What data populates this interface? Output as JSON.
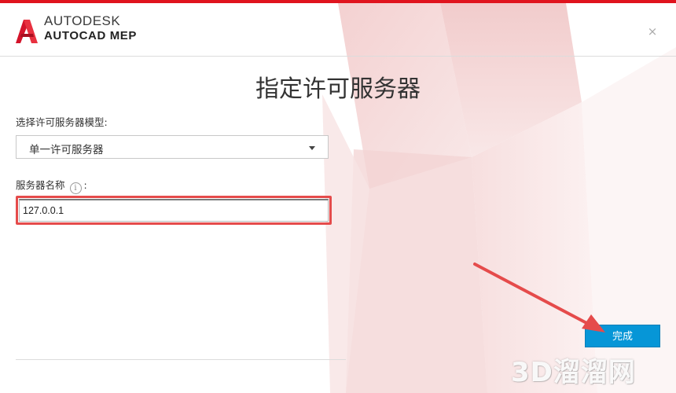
{
  "header": {
    "brand_line1": "AUTODESK",
    "brand_line2": "AUTOCAD MEP",
    "close_glyph": "×"
  },
  "main": {
    "title": "指定许可服务器",
    "server_model_label": "选择许可服务器模型:",
    "server_model_value": "单一许可服务器",
    "server_name_label": "服务器名称",
    "server_name_suffix": ":",
    "info_glyph": "i",
    "server_name_value": "127.0.0.1"
  },
  "footer": {
    "finish_label": "完成"
  },
  "watermark": {
    "text": "3D溜溜网"
  },
  "colors": {
    "accent_red": "#e0141e",
    "button_blue": "#0696d7",
    "annotation_red": "#e54b4b"
  },
  "icons": {
    "logo": "autodesk-a-logo",
    "close": "close-icon",
    "dropdown": "chevron-down-icon",
    "info": "info-icon"
  }
}
